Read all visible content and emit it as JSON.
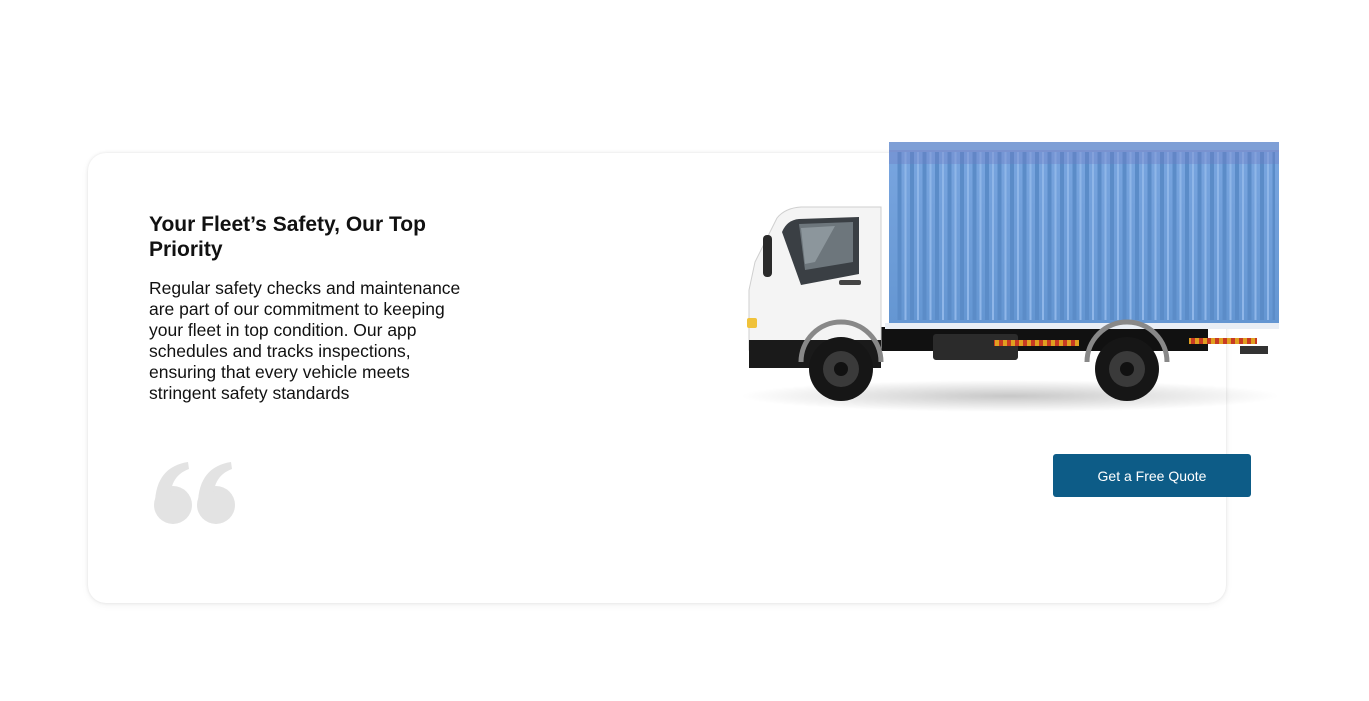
{
  "section": {
    "title": "Your Fleet’s Safety, Our Top Priority",
    "description": "Regular safety checks and maintenance are part of our commitment to keeping your fleet in top condition. Our app schedules and tracks inspections, ensuring that every vehicle meets stringent safety standards"
  },
  "cta": {
    "label": "Get a Free Quote"
  },
  "icons": {
    "quote": "quote-icon",
    "truck": "truck-image"
  },
  "colors": {
    "background": "#ffffff",
    "card": "#ffffff",
    "text": "#111111",
    "quote_mark": "#e3e3e3",
    "button": "#0d5c87",
    "button_text": "#ffffff",
    "container": "#6e9fd8"
  }
}
